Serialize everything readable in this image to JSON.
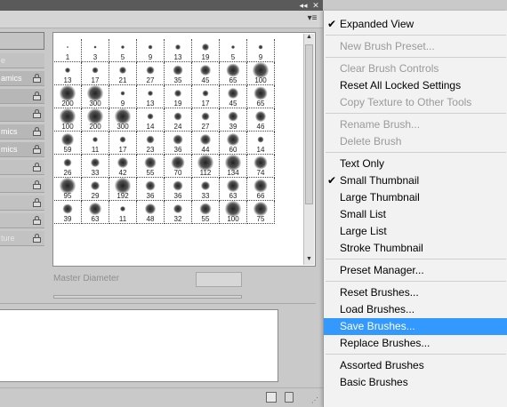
{
  "panel": {
    "title_ctrl_collapse": "◂◂",
    "title_ctrl_close": "✕",
    "menu_button_glyph": "▾≡"
  },
  "left_list": {
    "items": [
      {
        "label": "e",
        "locked": false,
        "plain": true
      },
      {
        "label": "amics",
        "locked": true,
        "plain": false
      },
      {
        "label": "",
        "locked": true,
        "plain": false
      },
      {
        "label": "",
        "locked": true,
        "plain": false
      },
      {
        "label": "mics",
        "locked": true,
        "plain": false
      },
      {
        "label": "mics",
        "locked": true,
        "plain": false
      },
      {
        "label": "",
        "locked": true,
        "plain": true
      },
      {
        "label": "",
        "locked": true,
        "plain": true
      },
      {
        "label": "",
        "locked": true,
        "plain": true
      },
      {
        "label": "",
        "locked": true,
        "plain": true
      },
      {
        "label": "ture",
        "locked": true,
        "plain": true
      }
    ]
  },
  "brushes": {
    "rows": [
      [
        "1",
        "3",
        "5",
        "9",
        "13",
        "19",
        "5",
        "9"
      ],
      [
        "13",
        "17",
        "21",
        "27",
        "35",
        "45",
        "65",
        "100"
      ],
      [
        "200",
        "300",
        "9",
        "13",
        "19",
        "17",
        "45",
        "65"
      ],
      [
        "100",
        "200",
        "300",
        "14",
        "24",
        "27",
        "39",
        "46"
      ],
      [
        "59",
        "11",
        "17",
        "23",
        "36",
        "44",
        "60",
        "14"
      ],
      [
        "26",
        "33",
        "42",
        "55",
        "70",
        "112",
        "134",
        "74"
      ],
      [
        "95",
        "29",
        "192",
        "36",
        "36",
        "33",
        "63",
        "66"
      ],
      [
        "39",
        "63",
        "11",
        "48",
        "32",
        "55",
        "100",
        "75"
      ]
    ],
    "master_diameter_label": "Master Diameter"
  },
  "menu": {
    "items": [
      {
        "label": "Expanded View",
        "checked": true,
        "disabled": false,
        "highlighted": false
      },
      {
        "sep": true
      },
      {
        "label": "New Brush Preset...",
        "checked": false,
        "disabled": true,
        "highlighted": false
      },
      {
        "sep": true
      },
      {
        "label": "Clear Brush Controls",
        "checked": false,
        "disabled": true,
        "highlighted": false
      },
      {
        "label": "Reset All Locked Settings",
        "checked": false,
        "disabled": false,
        "highlighted": false
      },
      {
        "label": "Copy Texture to Other Tools",
        "checked": false,
        "disabled": true,
        "highlighted": false
      },
      {
        "sep": true
      },
      {
        "label": "Rename Brush...",
        "checked": false,
        "disabled": true,
        "highlighted": false
      },
      {
        "label": "Delete Brush",
        "checked": false,
        "disabled": true,
        "highlighted": false
      },
      {
        "sep": true
      },
      {
        "label": "Text Only",
        "checked": false,
        "disabled": false,
        "highlighted": false
      },
      {
        "label": "Small Thumbnail",
        "checked": true,
        "disabled": false,
        "highlighted": false
      },
      {
        "label": "Large Thumbnail",
        "checked": false,
        "disabled": false,
        "highlighted": false
      },
      {
        "label": "Small List",
        "checked": false,
        "disabled": false,
        "highlighted": false
      },
      {
        "label": "Large List",
        "checked": false,
        "disabled": false,
        "highlighted": false
      },
      {
        "label": "Stroke Thumbnail",
        "checked": false,
        "disabled": false,
        "highlighted": false
      },
      {
        "sep": true
      },
      {
        "label": "Preset Manager...",
        "checked": false,
        "disabled": false,
        "highlighted": false
      },
      {
        "sep": true
      },
      {
        "label": "Reset Brushes...",
        "checked": false,
        "disabled": false,
        "highlighted": false
      },
      {
        "label": "Load Brushes...",
        "checked": false,
        "disabled": false,
        "highlighted": false
      },
      {
        "label": "Save Brushes...",
        "checked": false,
        "disabled": false,
        "highlighted": true
      },
      {
        "label": "Replace Brushes...",
        "checked": false,
        "disabled": false,
        "highlighted": false
      },
      {
        "sep": true
      },
      {
        "label": "Assorted Brushes",
        "checked": false,
        "disabled": false,
        "highlighted": false
      },
      {
        "label": "Basic Brushes",
        "checked": false,
        "disabled": false,
        "highlighted": false
      }
    ],
    "highlight_color": "#3399ff",
    "check_glyph": "✔"
  }
}
